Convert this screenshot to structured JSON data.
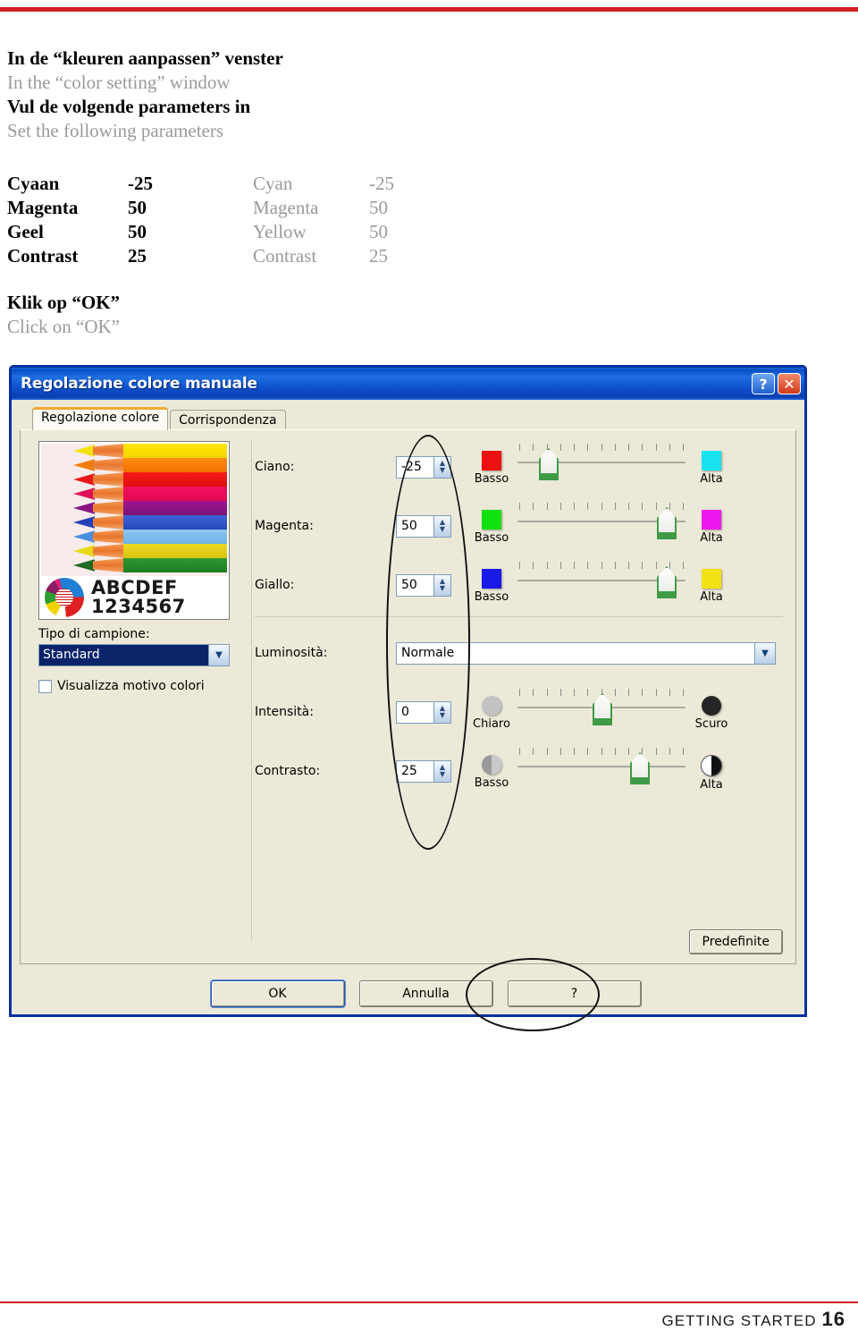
{
  "page": {
    "footer_label": "GETTING STARTED",
    "page_number": "16",
    "accent_color": "#d12026"
  },
  "instructions": [
    {
      "nl": "In de “kleuren aanpassen” venster",
      "en": "In the “color setting” window"
    },
    {
      "nl": "Vul de volgende parameters in",
      "en": "Set the following parameters"
    }
  ],
  "parameters": {
    "rows": [
      {
        "nl_label": "Cyaan",
        "nl_value": "-25",
        "en_label": "Cyan",
        "en_value": "-25"
      },
      {
        "nl_label": "Magenta",
        "nl_value": "50",
        "en_label": "Magenta",
        "en_value": "50"
      },
      {
        "nl_label": "Geel",
        "nl_value": "50",
        "en_label": "Yellow",
        "en_value": "50"
      },
      {
        "nl_label": "Contrast",
        "nl_value": "25",
        "en_label": "Contrast",
        "en_value": "25"
      }
    ]
  },
  "final_step": {
    "nl": "Klik op “OK”",
    "en": "Click on “OK”"
  },
  "dialog": {
    "title": "Regolazione colore manuale",
    "help_button": "?",
    "close_button": "✕",
    "tabs": [
      {
        "label": "Regolazione colore",
        "active": true
      },
      {
        "label": "Corrispondenza",
        "active": false
      }
    ],
    "preview": {
      "sample_text_letters": "ABCDEF",
      "sample_text_digits": "1234567"
    },
    "sample_type": {
      "label": "Tipo di campione:",
      "value": "Standard"
    },
    "color_pattern_checkbox": {
      "label": "Visualizza motivo colori",
      "checked": false
    },
    "controls": [
      {
        "label": "Ciano:",
        "value": "-25",
        "low": "Basso",
        "high": "Alta",
        "low_color": "#ee1111",
        "high_color": "#18e3ee",
        "thumb_pct": 25,
        "shape": "square"
      },
      {
        "label": "Magenta:",
        "value": "50",
        "low": "Basso",
        "high": "Alta",
        "low_color": "#11e011",
        "high_color": "#ee18ee",
        "thumb_pct": 100,
        "shape": "square"
      },
      {
        "label": "Giallo:",
        "value": "50",
        "low": "Basso",
        "high": "Alta",
        "low_color": "#1a1ae8",
        "high_color": "#f2e214",
        "thumb_pct": 100,
        "shape": "square"
      },
      {
        "label": "Luminosità:",
        "value": "Normale",
        "type": "combo"
      },
      {
        "label": "Intensità:",
        "value": "0",
        "low": "Chiaro",
        "high": "Scuro",
        "low_color": "#b9b9b9",
        "high_color": "#222222",
        "thumb_pct": 50,
        "shape": "circle"
      },
      {
        "label": "Contrasto:",
        "value": "25",
        "low": "Basso",
        "high": "Alta",
        "low_color": "#9a9a9a",
        "high_color": "#111111",
        "thumb_pct": 75,
        "shape": "circle-half"
      }
    ],
    "buttons": {
      "defaults": "Predefinite",
      "ok": "OK",
      "cancel": "Annulla",
      "help": "?"
    }
  }
}
